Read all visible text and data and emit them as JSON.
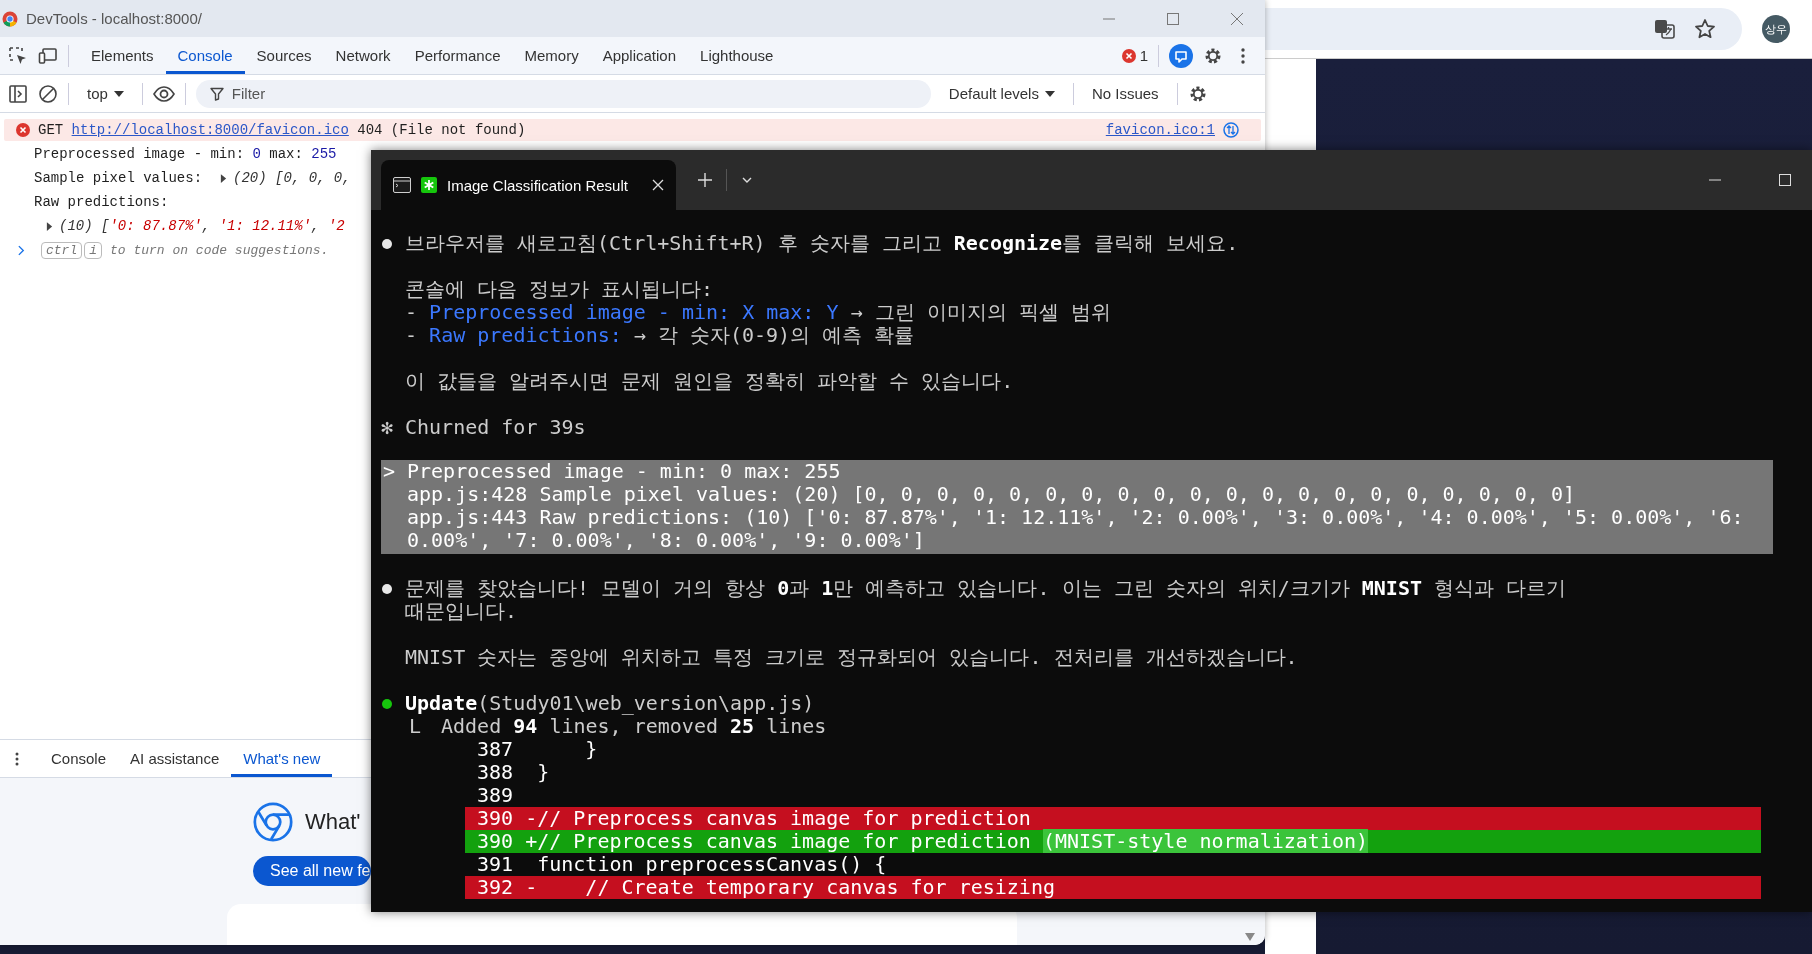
{
  "browser": {
    "avatar": "상우"
  },
  "devtools": {
    "window": {
      "title": "DevTools - localhost:8000/"
    },
    "tabs": [
      {
        "label": "Elements",
        "selected": false
      },
      {
        "label": "Console",
        "selected": true
      },
      {
        "label": "Sources",
        "selected": false
      },
      {
        "label": "Network",
        "selected": false
      },
      {
        "label": "Performance",
        "selected": false
      },
      {
        "label": "Memory",
        "selected": false
      },
      {
        "label": "Application",
        "selected": false
      },
      {
        "label": "Lighthouse",
        "selected": false
      }
    ],
    "error_count": "1",
    "toolbar": {
      "context": "top",
      "filter": {
        "placeholder": "Filter"
      },
      "levels": "Default levels",
      "issues": "No Issues"
    },
    "console": [
      {
        "kind": "error",
        "method": "GET",
        "url": "http://localhost:8000/favicon.ico",
        "message": "404 (File not found)",
        "source": "favicon.ico:1"
      },
      {
        "kind": "log",
        "segments": [
          {
            "kind": "plain",
            "text": "Preprocessed image - min: "
          },
          {
            "kind": "number",
            "text": "0"
          },
          {
            "kind": "plain",
            "text": " max: "
          },
          {
            "kind": "number",
            "text": "255"
          }
        ]
      },
      {
        "kind": "log",
        "segments": [
          {
            "kind": "plain",
            "text": "Sample pixel values:"
          }
        ],
        "preview": {
          "expandable": true,
          "segments": [
            {
              "kind": "object",
              "text": "(20) [0, 0, 0,"
            }
          ]
        }
      },
      {
        "kind": "log",
        "segments": [
          {
            "kind": "plain",
            "text": "Raw predictions:"
          }
        ]
      },
      {
        "kind": "object",
        "expandable": true,
        "segments": [
          {
            "kind": "object",
            "text": "(10) ["
          },
          {
            "kind": "string",
            "text": "'0: 87.87%'"
          },
          {
            "kind": "object",
            "text": ", "
          },
          {
            "kind": "string",
            "text": "'1: 12.11%'"
          },
          {
            "kind": "object",
            "text": ", "
          },
          {
            "kind": "string",
            "text": "'2"
          }
        ]
      },
      {
        "kind": "prompt",
        "keys": [
          "ctrl",
          "i"
        ],
        "text": "to turn on code suggestions."
      }
    ],
    "drawer": {
      "tabs": [
        {
          "label": "Console",
          "selected": false
        },
        {
          "label": "AI assistance",
          "selected": false
        },
        {
          "label": "What's new",
          "selected": true
        }
      ],
      "title": "What'",
      "button": "See all new fe"
    }
  },
  "terminal": {
    "tab": {
      "title": "Image Classification Result",
      "selected": true
    },
    "lines": [
      {
        "kind": "bullet",
        "color": "#e8e8e8",
        "text": "브라우저를 새로고침(Ctrl+Shift+R) 후 숫자를 그리고 **Recognize**를 클릭해 보세요."
      },
      {
        "kind": "blank"
      },
      {
        "kind": "text",
        "text": "콘솔에 다음 정보가 표시됩니다:"
      },
      {
        "kind": "hint",
        "lead": "- ",
        "term": "Preprocessed image - min: X max: Y",
        "text": " → 그린 이미지의 픽셀 범위"
      },
      {
        "kind": "hint",
        "lead": "- ",
        "term": "Raw predictions:",
        "text": " → 각 숫자(0-9)의 예측 확률"
      },
      {
        "kind": "blank"
      },
      {
        "kind": "text",
        "text": "이 값들을 알려주시면 문제 원인을 정확히 파악할 수 있습니다."
      },
      {
        "kind": "blank"
      },
      {
        "kind": "status",
        "glyph": "✻",
        "text": "Churned for 39s"
      },
      {
        "kind": "blank"
      },
      {
        "kind": "output",
        "prompt": ">",
        "lines": [
          "Preprocessed image - min: 0 max: 255",
          "app.js:428 Sample pixel values: (20) [0, 0, 0, 0, 0, 0, 0, 0, 0, 0, 0, 0, 0, 0, 0, 0, 0, 0, 0, 0]",
          "app.js:443 Raw predictions: (10) ['0: 87.87%', '1: 12.11%', '2: 0.00%', '3: 0.00%', '4: 0.00%', '5: 0.00%', '6:",
          "0.00%', '7: 0.00%', '8: 0.00%', '9: 0.00%']"
        ]
      },
      {
        "kind": "blank"
      },
      {
        "kind": "bullet",
        "color": "#e8e8e8",
        "text": "문제를 찾았습니다! 모델이 거의 항상 **0**과 **1**만 예측하고 있습니다. 이는 그린 숫자의 위치/크기가 **MNIST** 형식과 다르기"
      },
      {
        "kind": "text",
        "text": "때문입니다."
      },
      {
        "kind": "blank"
      },
      {
        "kind": "text",
        "text": "MNIST 숫자는 중앙에 위치하고 특정 크기로 정규화되어 있습니다. 전처리를 개선하겠습니다."
      },
      {
        "kind": "blank"
      },
      {
        "kind": "bullet",
        "color": "#16c60c",
        "text": "**Update**(Study01\\web_version\\app.js)"
      },
      {
        "kind": "tree",
        "glyph": "L",
        "text": "Added **94** lines, removed **25** lines"
      },
      {
        "kind": "context",
        "number": "387",
        "code": "    }"
      },
      {
        "kind": "context",
        "number": "388",
        "code": "}"
      },
      {
        "kind": "context",
        "number": "389"
      },
      {
        "kind": "removed",
        "number": "390",
        "sign": "-",
        "code": "// Preprocess canvas image for prediction"
      },
      {
        "kind": "added",
        "number": "390",
        "sign": "+",
        "code": "// Preprocess canvas image for prediction ",
        "inserted": "(MNIST-style normalization)"
      },
      {
        "kind": "context",
        "number": "391",
        "code": "function preprocessCanvas() {"
      },
      {
        "kind": "removed",
        "number": "392",
        "sign": "-",
        "code": "    // Create temporary canvas for resizing"
      }
    ]
  }
}
